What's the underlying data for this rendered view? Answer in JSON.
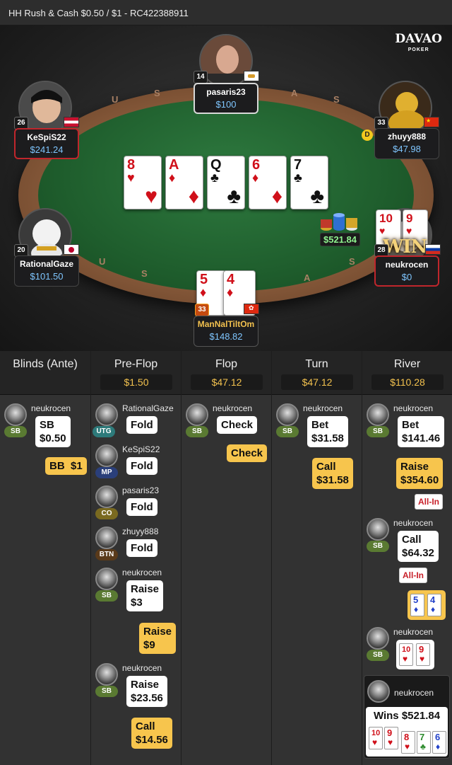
{
  "title": "HH  Rush & Cash $0.50 / $1   - RC422388911",
  "logo": {
    "main": "DAVAO",
    "sub": "POKER"
  },
  "rail_letters": [
    "U",
    "S",
    "A",
    "S",
    "U",
    "S",
    "A",
    "S"
  ],
  "board": [
    {
      "rank": "8",
      "suit": "♥",
      "color": "red"
    },
    {
      "rank": "A",
      "suit": "♦",
      "color": "red"
    },
    {
      "rank": "Q",
      "suit": "♣",
      "color": "black"
    },
    {
      "rank": "6",
      "suit": "♦",
      "color": "red"
    },
    {
      "rank": "7",
      "suit": "♣",
      "color": "black"
    }
  ],
  "pot": "$521.84",
  "players": {
    "pasaris": {
      "name": "pasaris23",
      "stack": "$100",
      "level": "14"
    },
    "kespis": {
      "name": "KeSpiS22",
      "stack": "$241.24",
      "level": "26"
    },
    "zhuyy": {
      "name": "zhuyy888",
      "stack": "$47.98",
      "level": "33",
      "dealer": "D"
    },
    "rational": {
      "name": "RationalGaze",
      "stack": "$101.50",
      "level": "20"
    },
    "neukrocen": {
      "name": "neukrocen",
      "stack": "$0",
      "level": "28",
      "win": "WIN",
      "cards": [
        {
          "rank": "10",
          "suit": "♥"
        },
        {
          "rank": "9",
          "suit": "♥"
        }
      ]
    },
    "mannal": {
      "name": "ManNalTiltOm",
      "stack": "$148.82",
      "level": "33",
      "cards": [
        {
          "rank": "5",
          "suit": "♦"
        },
        {
          "rank": "4",
          "suit": "♦"
        }
      ]
    }
  },
  "columns": [
    {
      "title": "Blinds (Ante)",
      "pot": ""
    },
    {
      "title": "Pre-Flop",
      "pot": "$1.50"
    },
    {
      "title": "Flop",
      "pot": "$47.12"
    },
    {
      "title": "Turn",
      "pot": "$47.12"
    },
    {
      "title": "River",
      "pot": "$110.28"
    }
  ],
  "blinds": {
    "sb": {
      "name": "neukrocen",
      "pos": "SB",
      "action": "SB",
      "amount": "$0.50"
    },
    "bb": {
      "action": "BB",
      "amount": "$1"
    }
  },
  "preflop": [
    {
      "name": "RationalGaze",
      "pos": "UTG",
      "action": "Fold"
    },
    {
      "name": "KeSpiS22",
      "pos": "MP",
      "action": "Fold"
    },
    {
      "name": "pasaris23",
      "pos": "CO",
      "action": "Fold"
    },
    {
      "name": "zhuyy888",
      "pos": "BTN",
      "action": "Fold"
    },
    {
      "name": "neukrocen",
      "pos": "SB",
      "action": "Raise",
      "amount": "$3"
    },
    {
      "opp": true,
      "action": "Raise",
      "amount": "$9"
    },
    {
      "name": "neukrocen",
      "pos": "SB",
      "action": "Raise",
      "amount": "$23.56"
    },
    {
      "opp": true,
      "action": "Call",
      "amount": "$14.56"
    }
  ],
  "flop": [
    {
      "name": "neukrocen",
      "pos": "SB",
      "action": "Check"
    },
    {
      "opp": true,
      "action": "Check"
    }
  ],
  "turn": [
    {
      "name": "neukrocen",
      "pos": "SB",
      "action": "Bet",
      "amount": "$31.58"
    },
    {
      "opp": true,
      "action": "Call",
      "amount": "$31.58"
    }
  ],
  "river": [
    {
      "name": "neukrocen",
      "pos": "SB",
      "action": "Bet",
      "amount": "$141.46"
    },
    {
      "opp": true,
      "action": "Raise",
      "amount": "$354.60",
      "allin": "All-In"
    },
    {
      "name": "neukrocen",
      "pos": "SB",
      "action": "Call",
      "amount": "$64.32",
      "allin": "All-In"
    }
  ],
  "showdown": {
    "opp_cards": [
      {
        "rank": "5",
        "suit": "♦"
      },
      {
        "rank": "4",
        "suit": "♦"
      }
    ],
    "hero_name": "neukrocen",
    "hero_pos": "SB",
    "hero_cards": [
      {
        "rank": "10",
        "suit": "♥"
      },
      {
        "rank": "9",
        "suit": "♥"
      }
    ],
    "winner": "neukrocen",
    "wins": "Wins $521.84",
    "win_cards": [
      {
        "rank": "10",
        "suit": "♥",
        "c": "red"
      },
      {
        "rank": "9",
        "suit": "♥",
        "c": "red"
      },
      {
        "rank": "8",
        "suit": "♥",
        "c": "red"
      },
      {
        "rank": "7",
        "suit": "♣",
        "c": "green"
      },
      {
        "rank": "6",
        "suit": "♦",
        "c": "blue"
      }
    ]
  }
}
